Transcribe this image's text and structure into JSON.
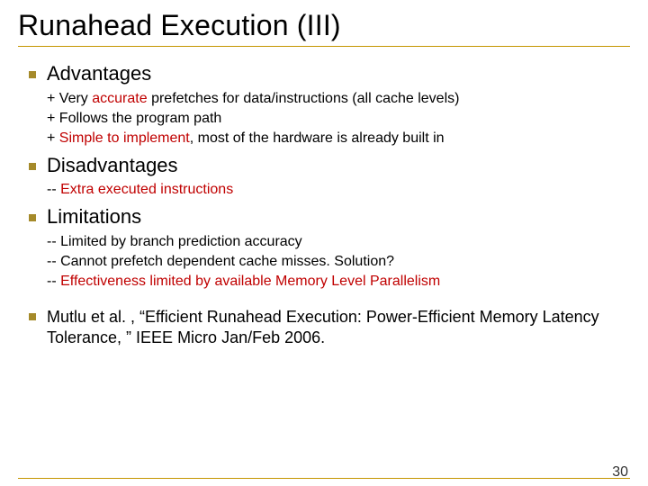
{
  "title": "Runahead Execution (III)",
  "sections": {
    "advantages": {
      "heading": "Advantages",
      "l1_pre": "+ Very ",
      "l1_em": "accurate",
      "l1_post": " prefetches for data/instructions (all cache levels)",
      "l1a": "+ Follows the program path",
      "l2_pre": "+ ",
      "l2_em": "Simple to implement",
      "l2_post": ", most of the hardware is already built in"
    },
    "disadvantages": {
      "heading": "Disadvantages",
      "d1_pre": "-- ",
      "d1_em": "Extra executed instructions"
    },
    "limitations": {
      "heading": "Limitations",
      "l1": "-- Limited by branch prediction accuracy",
      "l2": "-- Cannot prefetch dependent cache misses. Solution?",
      "l3_pre": "-- ",
      "l3_em": "Effectiveness limited by available Memory Level Parallelism"
    },
    "ref": "Mutlu et al. , “Efficient Runahead Execution: Power-Efficient Memory Latency Tolerance, ” IEEE Micro Jan/Feb 2006."
  },
  "page_number": "30"
}
